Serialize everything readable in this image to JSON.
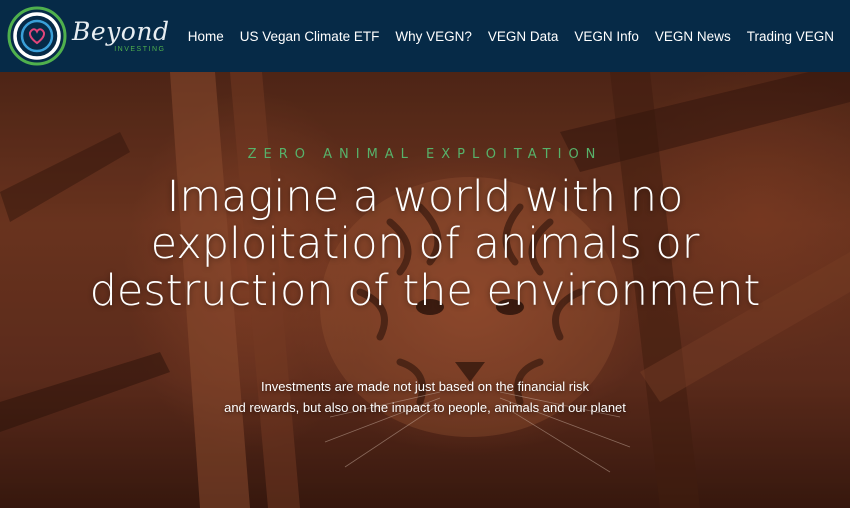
{
  "brand": {
    "name": "Beyond",
    "tagline": "INVESTING"
  },
  "nav": {
    "items": [
      {
        "label": "Home"
      },
      {
        "label": "US Vegan Climate ETF"
      },
      {
        "label": "Why VEGN?"
      },
      {
        "label": "VEGN Data"
      },
      {
        "label": "VEGN Info"
      },
      {
        "label": "VEGN News"
      },
      {
        "label": "Trading VEGN"
      }
    ]
  },
  "hero": {
    "eyebrow": "ZERO ANIMAL EXPLOITATION",
    "headline_lines": [
      "Imagine a world with no",
      "exploitation of animals or",
      "destruction of the environment"
    ],
    "subtext_lines": [
      "Investments are made not just based on the financial risk",
      "and rewards, but also on the impact to people, animals and our planet"
    ],
    "background_image": "tiger-in-forest-orange-tinted"
  },
  "colors": {
    "navbar_bg": "#062a47",
    "accent_green": "#57b26a",
    "hero_tint": "#7b3d24"
  }
}
